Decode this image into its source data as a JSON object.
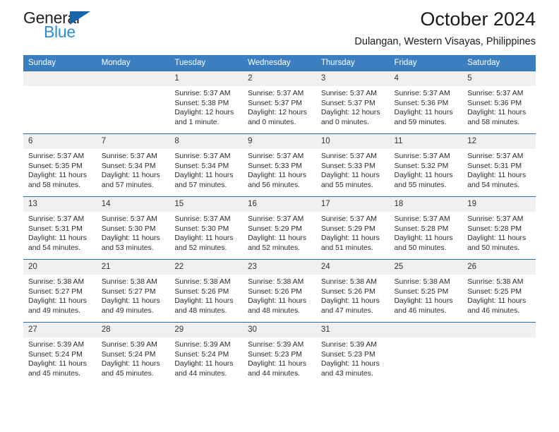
{
  "brand": {
    "name_top": "General",
    "name_bottom": "Blue",
    "accent_color": "#2a8ddd",
    "triangle_color": "#1666ad"
  },
  "header": {
    "title": "October 2024",
    "location": "Dulangan, Western Visayas, Philippines"
  },
  "calendar": {
    "header_bg": "#3c7fc1",
    "row_border_color": "#2e6da4",
    "daynum_bg": "#f0f0f0",
    "weekday_headers": [
      "Sunday",
      "Monday",
      "Tuesday",
      "Wednesday",
      "Thursday",
      "Friday",
      "Saturday"
    ],
    "weeks": [
      [
        {
          "day": ""
        },
        {
          "day": ""
        },
        {
          "day": "1",
          "sunrise": "Sunrise: 5:37 AM",
          "sunset": "Sunset: 5:38 PM",
          "daylight1": "Daylight: 12 hours",
          "daylight2": "and 1 minute."
        },
        {
          "day": "2",
          "sunrise": "Sunrise: 5:37 AM",
          "sunset": "Sunset: 5:37 PM",
          "daylight1": "Daylight: 12 hours",
          "daylight2": "and 0 minutes."
        },
        {
          "day": "3",
          "sunrise": "Sunrise: 5:37 AM",
          "sunset": "Sunset: 5:37 PM",
          "daylight1": "Daylight: 12 hours",
          "daylight2": "and 0 minutes."
        },
        {
          "day": "4",
          "sunrise": "Sunrise: 5:37 AM",
          "sunset": "Sunset: 5:36 PM",
          "daylight1": "Daylight: 11 hours",
          "daylight2": "and 59 minutes."
        },
        {
          "day": "5",
          "sunrise": "Sunrise: 5:37 AM",
          "sunset": "Sunset: 5:36 PM",
          "daylight1": "Daylight: 11 hours",
          "daylight2": "and 58 minutes."
        }
      ],
      [
        {
          "day": "6",
          "sunrise": "Sunrise: 5:37 AM",
          "sunset": "Sunset: 5:35 PM",
          "daylight1": "Daylight: 11 hours",
          "daylight2": "and 58 minutes."
        },
        {
          "day": "7",
          "sunrise": "Sunrise: 5:37 AM",
          "sunset": "Sunset: 5:34 PM",
          "daylight1": "Daylight: 11 hours",
          "daylight2": "and 57 minutes."
        },
        {
          "day": "8",
          "sunrise": "Sunrise: 5:37 AM",
          "sunset": "Sunset: 5:34 PM",
          "daylight1": "Daylight: 11 hours",
          "daylight2": "and 57 minutes."
        },
        {
          "day": "9",
          "sunrise": "Sunrise: 5:37 AM",
          "sunset": "Sunset: 5:33 PM",
          "daylight1": "Daylight: 11 hours",
          "daylight2": "and 56 minutes."
        },
        {
          "day": "10",
          "sunrise": "Sunrise: 5:37 AM",
          "sunset": "Sunset: 5:33 PM",
          "daylight1": "Daylight: 11 hours",
          "daylight2": "and 55 minutes."
        },
        {
          "day": "11",
          "sunrise": "Sunrise: 5:37 AM",
          "sunset": "Sunset: 5:32 PM",
          "daylight1": "Daylight: 11 hours",
          "daylight2": "and 55 minutes."
        },
        {
          "day": "12",
          "sunrise": "Sunrise: 5:37 AM",
          "sunset": "Sunset: 5:31 PM",
          "daylight1": "Daylight: 11 hours",
          "daylight2": "and 54 minutes."
        }
      ],
      [
        {
          "day": "13",
          "sunrise": "Sunrise: 5:37 AM",
          "sunset": "Sunset: 5:31 PM",
          "daylight1": "Daylight: 11 hours",
          "daylight2": "and 54 minutes."
        },
        {
          "day": "14",
          "sunrise": "Sunrise: 5:37 AM",
          "sunset": "Sunset: 5:30 PM",
          "daylight1": "Daylight: 11 hours",
          "daylight2": "and 53 minutes."
        },
        {
          "day": "15",
          "sunrise": "Sunrise: 5:37 AM",
          "sunset": "Sunset: 5:30 PM",
          "daylight1": "Daylight: 11 hours",
          "daylight2": "and 52 minutes."
        },
        {
          "day": "16",
          "sunrise": "Sunrise: 5:37 AM",
          "sunset": "Sunset: 5:29 PM",
          "daylight1": "Daylight: 11 hours",
          "daylight2": "and 52 minutes."
        },
        {
          "day": "17",
          "sunrise": "Sunrise: 5:37 AM",
          "sunset": "Sunset: 5:29 PM",
          "daylight1": "Daylight: 11 hours",
          "daylight2": "and 51 minutes."
        },
        {
          "day": "18",
          "sunrise": "Sunrise: 5:37 AM",
          "sunset": "Sunset: 5:28 PM",
          "daylight1": "Daylight: 11 hours",
          "daylight2": "and 50 minutes."
        },
        {
          "day": "19",
          "sunrise": "Sunrise: 5:37 AM",
          "sunset": "Sunset: 5:28 PM",
          "daylight1": "Daylight: 11 hours",
          "daylight2": "and 50 minutes."
        }
      ],
      [
        {
          "day": "20",
          "sunrise": "Sunrise: 5:38 AM",
          "sunset": "Sunset: 5:27 PM",
          "daylight1": "Daylight: 11 hours",
          "daylight2": "and 49 minutes."
        },
        {
          "day": "21",
          "sunrise": "Sunrise: 5:38 AM",
          "sunset": "Sunset: 5:27 PM",
          "daylight1": "Daylight: 11 hours",
          "daylight2": "and 49 minutes."
        },
        {
          "day": "22",
          "sunrise": "Sunrise: 5:38 AM",
          "sunset": "Sunset: 5:26 PM",
          "daylight1": "Daylight: 11 hours",
          "daylight2": "and 48 minutes."
        },
        {
          "day": "23",
          "sunrise": "Sunrise: 5:38 AM",
          "sunset": "Sunset: 5:26 PM",
          "daylight1": "Daylight: 11 hours",
          "daylight2": "and 48 minutes."
        },
        {
          "day": "24",
          "sunrise": "Sunrise: 5:38 AM",
          "sunset": "Sunset: 5:26 PM",
          "daylight1": "Daylight: 11 hours",
          "daylight2": "and 47 minutes."
        },
        {
          "day": "25",
          "sunrise": "Sunrise: 5:38 AM",
          "sunset": "Sunset: 5:25 PM",
          "daylight1": "Daylight: 11 hours",
          "daylight2": "and 46 minutes."
        },
        {
          "day": "26",
          "sunrise": "Sunrise: 5:38 AM",
          "sunset": "Sunset: 5:25 PM",
          "daylight1": "Daylight: 11 hours",
          "daylight2": "and 46 minutes."
        }
      ],
      [
        {
          "day": "27",
          "sunrise": "Sunrise: 5:39 AM",
          "sunset": "Sunset: 5:24 PM",
          "daylight1": "Daylight: 11 hours",
          "daylight2": "and 45 minutes."
        },
        {
          "day": "28",
          "sunrise": "Sunrise: 5:39 AM",
          "sunset": "Sunset: 5:24 PM",
          "daylight1": "Daylight: 11 hours",
          "daylight2": "and 45 minutes."
        },
        {
          "day": "29",
          "sunrise": "Sunrise: 5:39 AM",
          "sunset": "Sunset: 5:24 PM",
          "daylight1": "Daylight: 11 hours",
          "daylight2": "and 44 minutes."
        },
        {
          "day": "30",
          "sunrise": "Sunrise: 5:39 AM",
          "sunset": "Sunset: 5:23 PM",
          "daylight1": "Daylight: 11 hours",
          "daylight2": "and 44 minutes."
        },
        {
          "day": "31",
          "sunrise": "Sunrise: 5:39 AM",
          "sunset": "Sunset: 5:23 PM",
          "daylight1": "Daylight: 11 hours",
          "daylight2": "and 43 minutes."
        },
        {
          "day": ""
        },
        {
          "day": ""
        }
      ]
    ]
  }
}
